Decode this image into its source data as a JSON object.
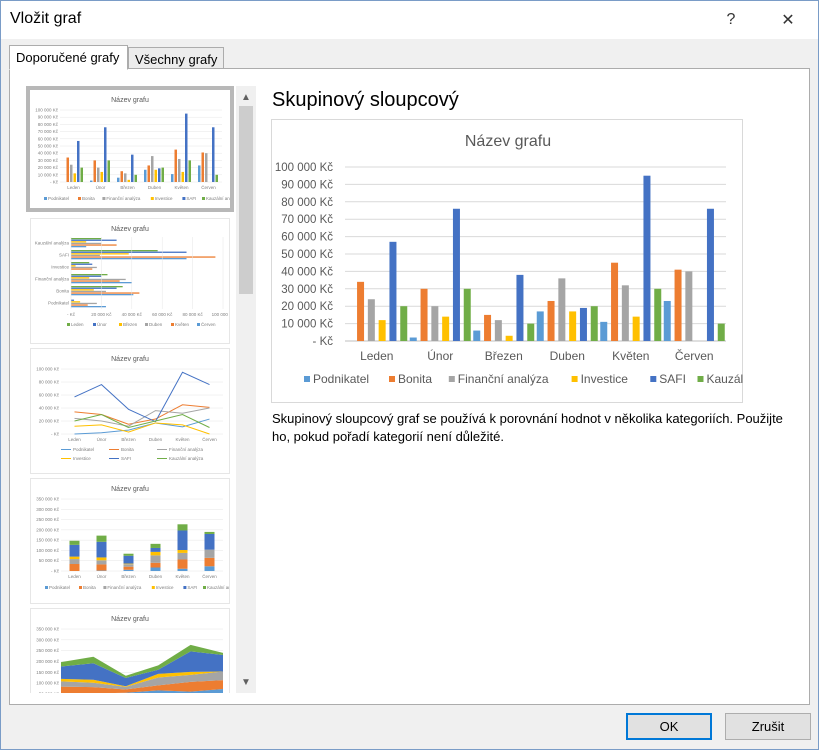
{
  "window": {
    "title": "Vložit graf",
    "help": "?",
    "close": "✕"
  },
  "tabs": [
    {
      "label": "Doporučené grafy"
    },
    {
      "label": "Všechny grafy"
    }
  ],
  "preview": {
    "name": "Skupinový sloupcový",
    "description": "Skupinový sloupcový graf se používá k porovnání hodnot v několika kategoriích. Použijte ho, pokud pořadí kategorií není důležité."
  },
  "buttons": {
    "ok": "OK",
    "cancel": "Zrušit"
  },
  "colors": {
    "Podnikatel": "#5b9bd5",
    "Bonita": "#ed7d31",
    "Finanční analýza": "#a5a5a5",
    "Investice": "#ffc000",
    "SAFI": "#4472c4",
    "Kauzální analýza": "#70ad47"
  },
  "thumbnails": [
    {
      "title": "Název grafu",
      "kind": "column",
      "selected": true
    },
    {
      "title": "Název grafu",
      "kind": "bar",
      "selected": false
    },
    {
      "title": "Název grafu",
      "kind": "line",
      "selected": false
    },
    {
      "title": "Název grafu",
      "kind": "stacked",
      "selected": false
    },
    {
      "title": "Název grafu",
      "kind": "area",
      "selected": false
    }
  ],
  "chart_data": {
    "type": "bar",
    "title": "Název grafu",
    "categories": [
      "Leden",
      "Únor",
      "Březen",
      "Duben",
      "Květen",
      "Červen"
    ],
    "yticks": [
      "-  Kč",
      "10 000 Kč",
      "20 000 Kč",
      "30 000 Kč",
      "40 000 Kč",
      "50 000 Kč",
      "60 000 Kč",
      "70 000 Kč",
      "80 000 Kč",
      "90 000 Kč",
      "100 000 Kč"
    ],
    "ylim": [
      0,
      100000
    ],
    "legend_position": "bottom",
    "series": [
      {
        "name": "Podnikatel",
        "values": [
          0,
          2000,
          6000,
          17000,
          11000,
          23000
        ]
      },
      {
        "name": "Bonita",
        "values": [
          34000,
          30000,
          15000,
          23000,
          45000,
          41000
        ]
      },
      {
        "name": "Finanční analýza",
        "values": [
          24000,
          20000,
          12000,
          36000,
          32000,
          40000
        ]
      },
      {
        "name": "Investice",
        "values": [
          12000,
          14000,
          3000,
          17000,
          14000,
          0
        ]
      },
      {
        "name": "SAFI",
        "values": [
          57000,
          76000,
          38000,
          19000,
          95000,
          76000
        ]
      },
      {
        "name": "Kauzální analýza",
        "values": [
          20000,
          30000,
          10000,
          20000,
          30000,
          10000
        ]
      }
    ]
  }
}
